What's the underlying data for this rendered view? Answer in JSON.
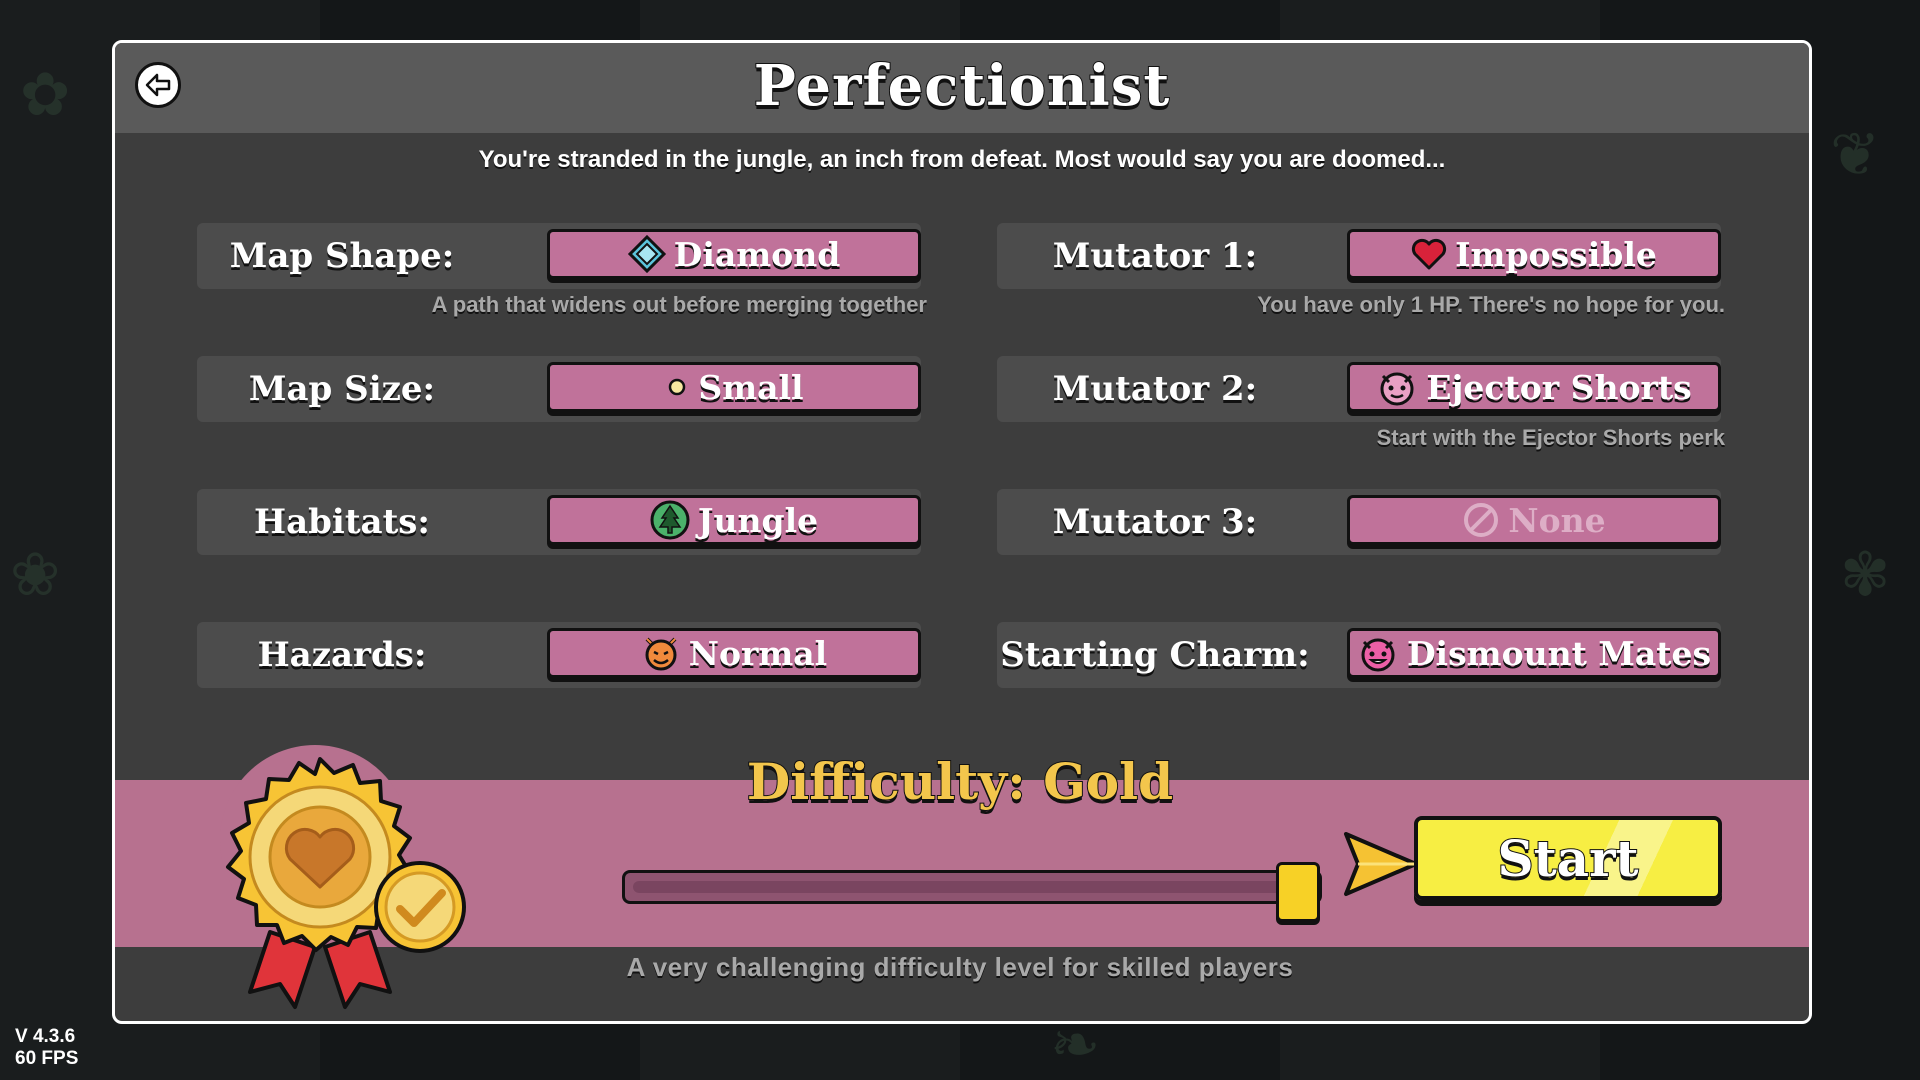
{
  "title": "Perfectionist",
  "subtitle": "You're stranded in the jungle, an inch from defeat. Most would say you are doomed...",
  "options_left": [
    {
      "label": "Map Shape:",
      "value": "Diamond",
      "icon": "diamond-icon",
      "desc": "A path that widens out before merging together"
    },
    {
      "label": "Map Size:",
      "value": "Small",
      "icon": "dot-icon",
      "desc": ""
    },
    {
      "label": "Habitats:",
      "value": "Jungle",
      "icon": "pine-tree-icon",
      "desc": ""
    },
    {
      "label": "Hazards:",
      "value": "Normal",
      "icon": "devil-face-icon",
      "desc": ""
    }
  ],
  "options_right": [
    {
      "label": "Mutator 1:",
      "value": "Impossible",
      "icon": "heart-icon",
      "desc": "You have only 1 HP. There's no hope for you."
    },
    {
      "label": "Mutator 2:",
      "value": "Ejector Shorts",
      "icon": "ejector-shorts-icon",
      "desc": "Start with the Ejector Shorts perk"
    },
    {
      "label": "Mutator 3:",
      "value": "None",
      "icon": "none-icon",
      "desc": ""
    },
    {
      "label": "Starting Charm:",
      "value": "Dismount Mates",
      "icon": "charm-face-icon",
      "desc": ""
    }
  ],
  "difficulty": {
    "title": "Difficulty: Gold",
    "description": "A very challenging difficulty level for skilled players",
    "level_fraction": 1.0
  },
  "start_label": "Start",
  "version": "V 4.3.6",
  "fps": "60 FPS",
  "colors": {
    "panel": "#3d3d3d",
    "header": "#5a5a5a",
    "button_pink": "#c0729a",
    "band_pink": "#b7718f",
    "gold": "#f3c64c",
    "start_yellow": "#f7ee43"
  }
}
